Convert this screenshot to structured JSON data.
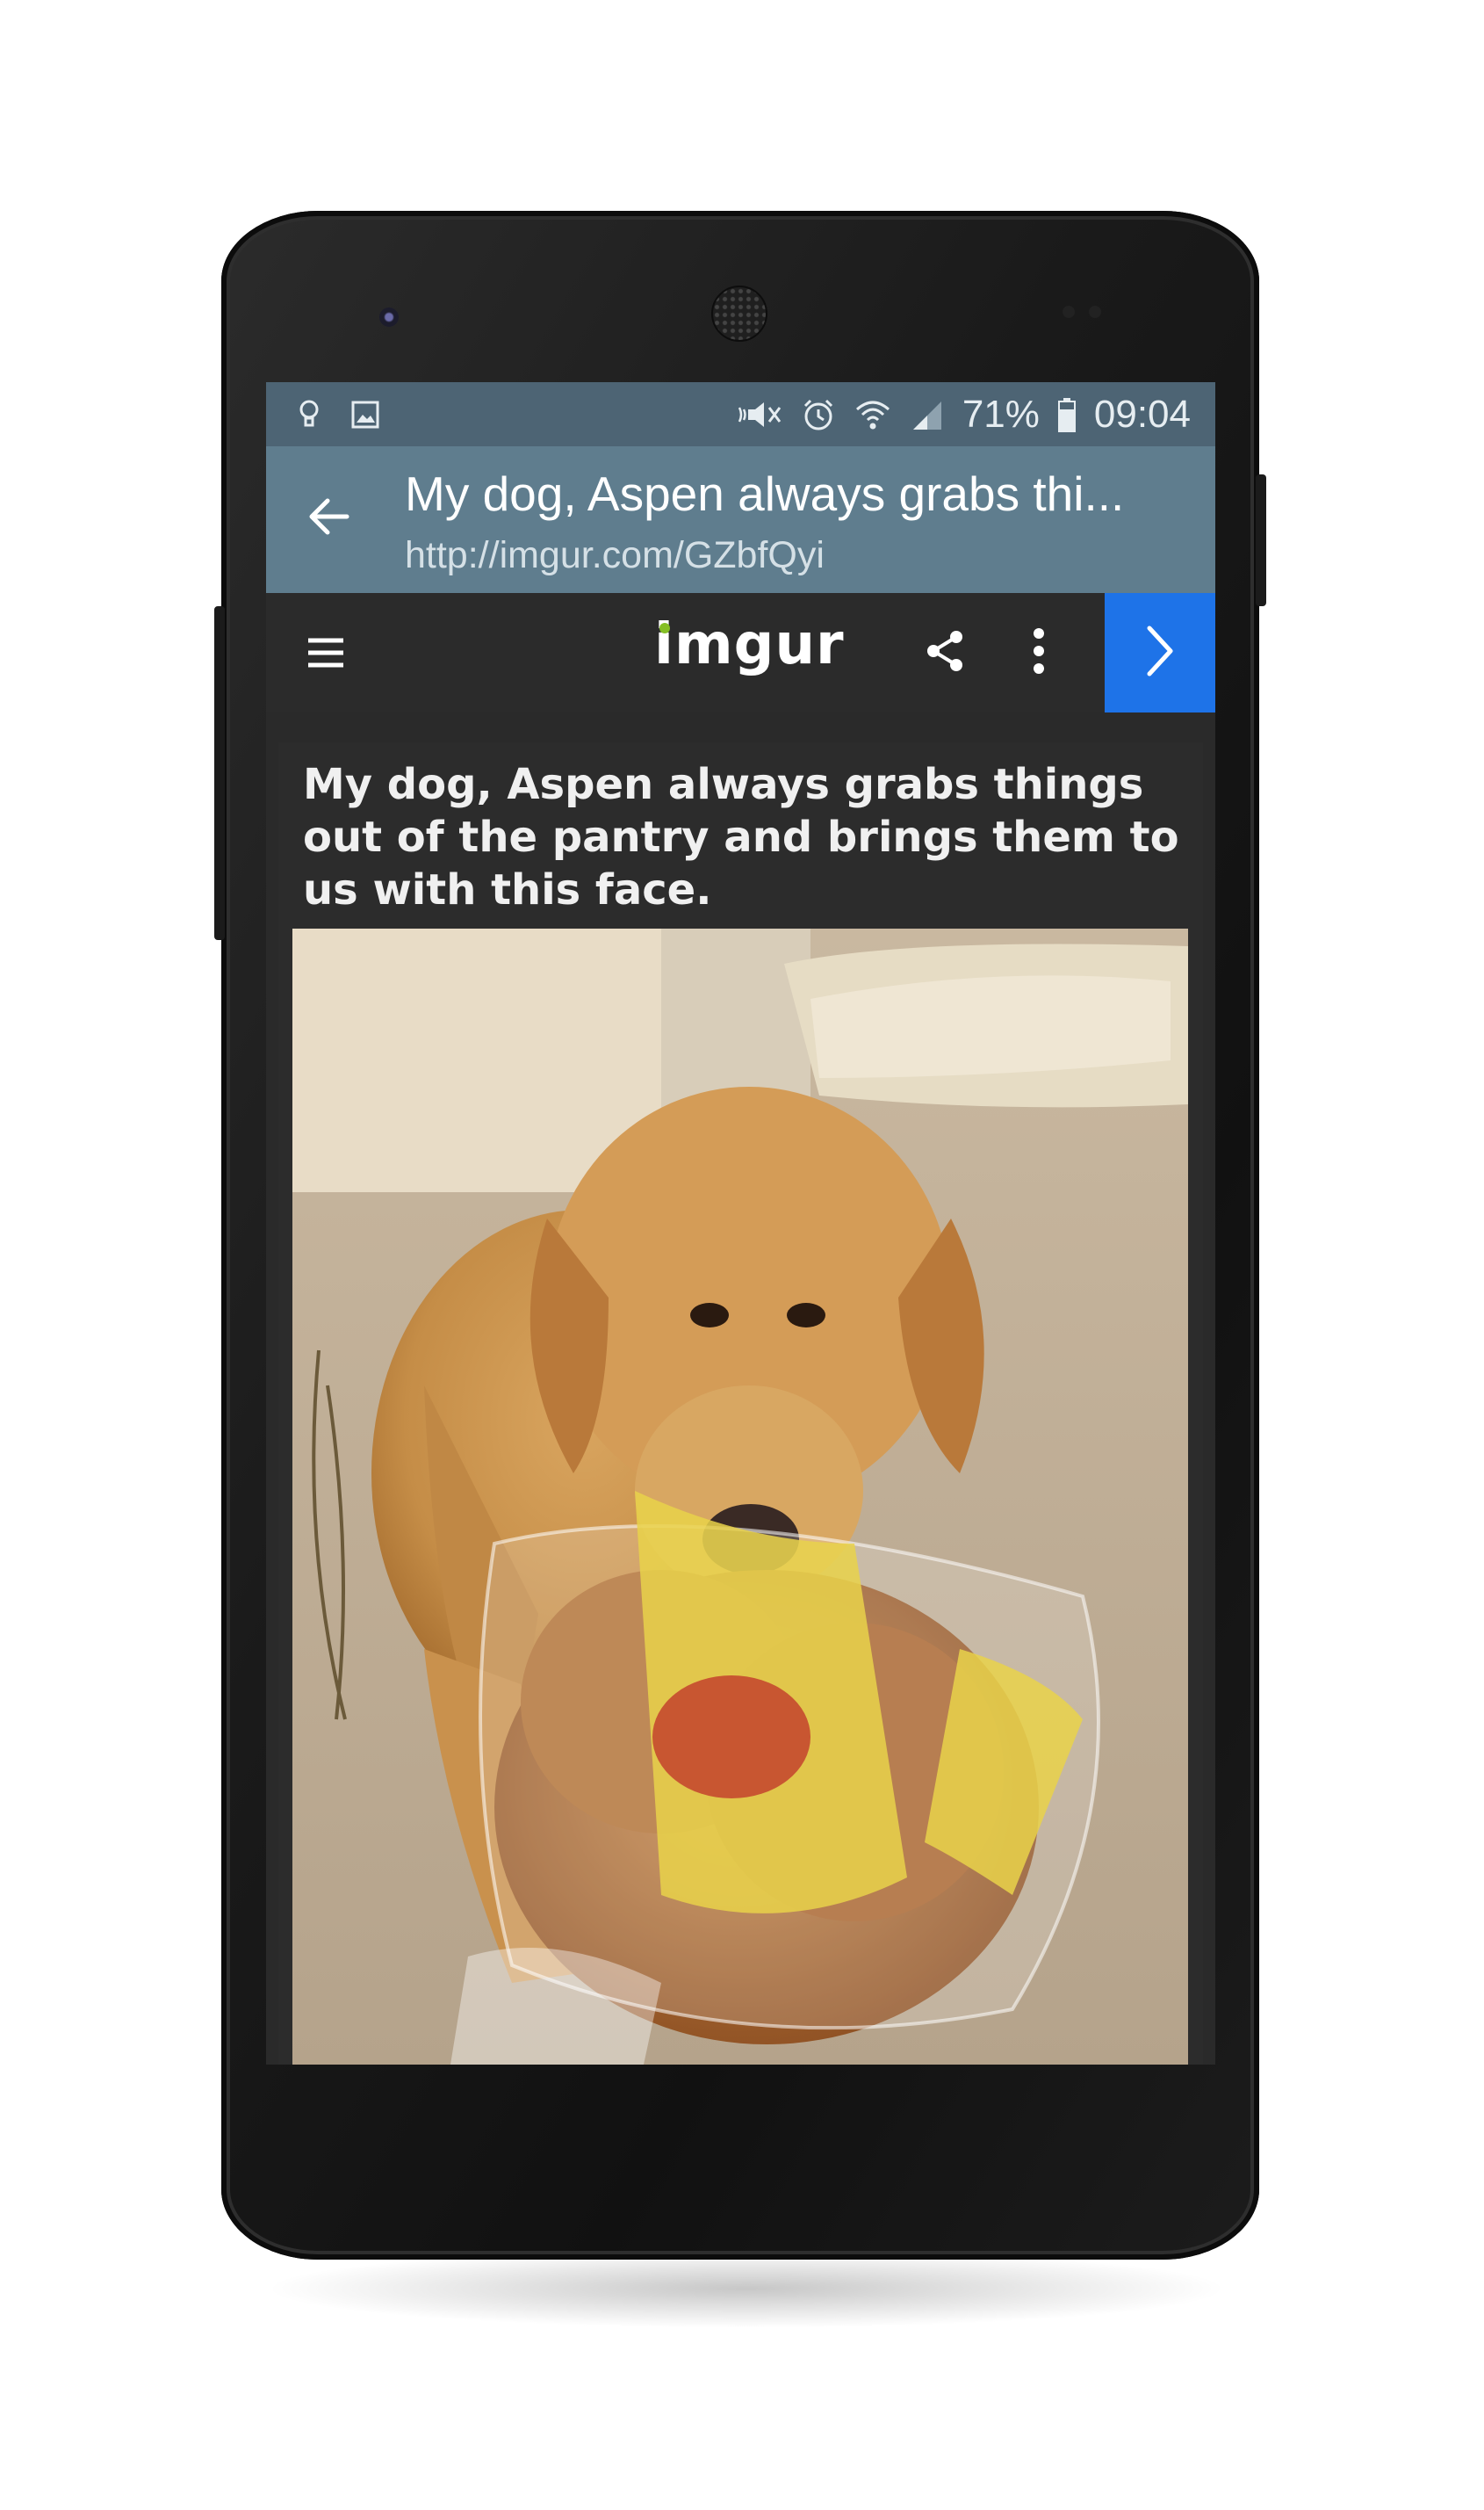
{
  "status_bar": {
    "battery": "71%",
    "time": "09:04",
    "icons": [
      "bulb-icon",
      "image-icon",
      "mute-icon",
      "alarm-icon",
      "wifi-icon",
      "signal-icon",
      "battery-icon"
    ]
  },
  "title_bar": {
    "title": "My dog, Aspen always grabs thi...",
    "url": "http://imgur.com/GZbfQyi"
  },
  "imgur_bar": {
    "logo": "imgur"
  },
  "post": {
    "title": "My dog, Aspen always grabs things out of the pantry and brings them to us with this face."
  },
  "colors": {
    "status_bar": "#4d6474",
    "title_bar": "#5f7d8e",
    "imgur_bar": "#2b2b2b",
    "next_button": "#1e73e8",
    "logo_dot": "#85bf25"
  }
}
